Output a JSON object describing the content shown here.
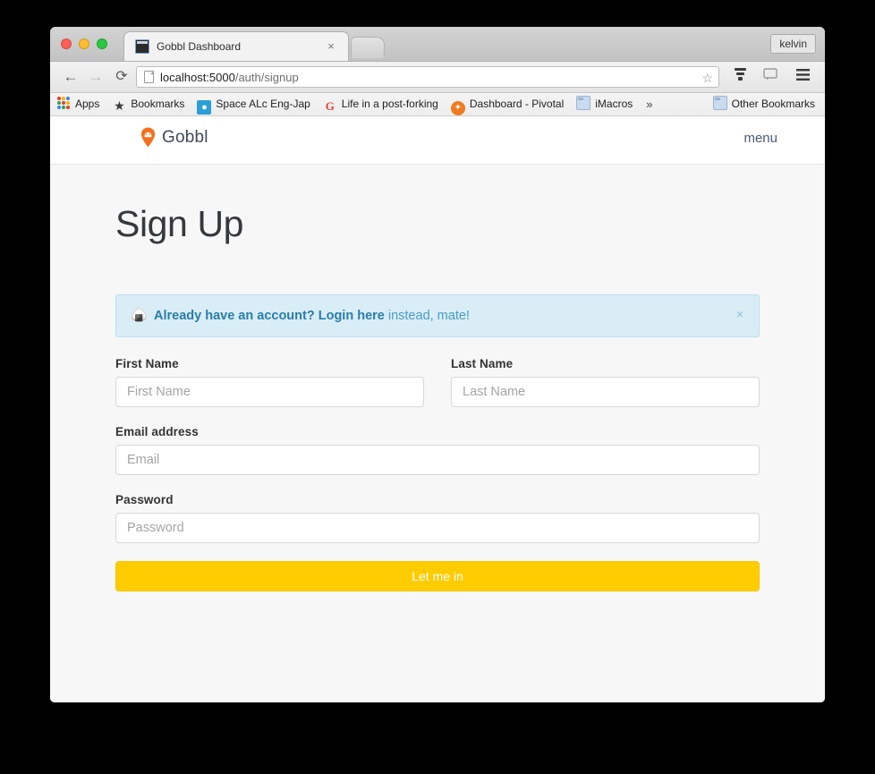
{
  "browser": {
    "profile_label": "kelvin",
    "tab": {
      "title": "Gobbl Dashboard",
      "favicon_name": "terminal-favicon",
      "close_label": "×"
    },
    "new_tab_label": "",
    "nav": {
      "back": "←",
      "forward": "→",
      "reload": "⟳"
    },
    "omnibox": {
      "url_host": "localhost:5000",
      "url_path": "/auth/signup",
      "full_url": "localhost:5000/auth/signup",
      "star": "☆"
    },
    "toolbar_icons": {
      "extension": "☲",
      "comment": "□",
      "menu": "≡"
    },
    "bookmarks": [
      {
        "label": "Apps",
        "icon": "apps-grid-icon"
      },
      {
        "label": "Bookmarks",
        "icon": "star-icon"
      },
      {
        "label": "Space ALc Eng-Jap",
        "icon": "blue-square-icon"
      },
      {
        "label": "Life in a post-forking",
        "icon": "google-g-icon"
      },
      {
        "label": "Dashboard - Pivotal",
        "icon": "orange-circle-icon"
      },
      {
        "label": "iMacros",
        "icon": "folder-icon"
      }
    ],
    "bookmarks_overflow": "»",
    "other_bookmarks": {
      "label": "Other Bookmarks",
      "icon": "folder-icon"
    }
  },
  "site": {
    "brand": {
      "name": "Gobbl",
      "pin_color": "#f4701e"
    },
    "nav": {
      "menu_label": "menu"
    }
  },
  "page": {
    "title": "Sign Up",
    "alert": {
      "emoji": "🍙",
      "link_text": "Already have an account? Login here",
      "tail_text": " instead, mate!",
      "close_label": "×"
    },
    "form": {
      "fields": [
        {
          "label": "First Name",
          "placeholder": "First Name",
          "value": "",
          "type": "text"
        },
        {
          "label": "Last Name",
          "placeholder": "Last Name",
          "value": "",
          "type": "text"
        },
        {
          "label": "Email address",
          "placeholder": "Email",
          "value": "",
          "type": "email"
        },
        {
          "label": "Password",
          "placeholder": "Password",
          "value": "",
          "type": "password"
        }
      ],
      "submit_label": "Let me in",
      "submit_color": "#ffcc00"
    }
  }
}
